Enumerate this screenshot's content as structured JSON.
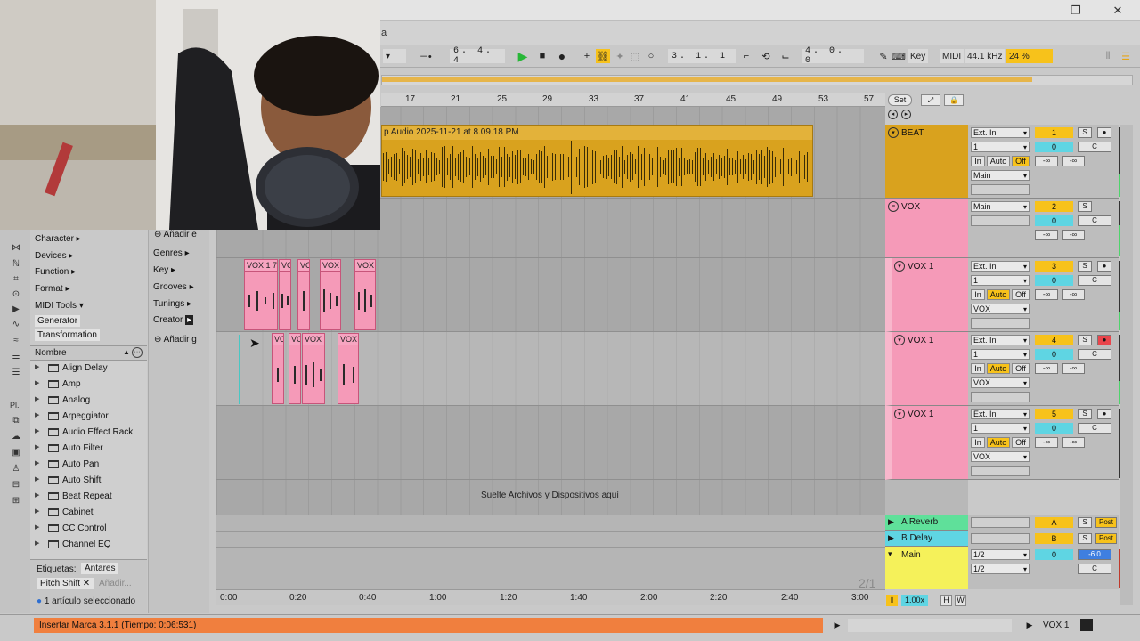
{
  "window": {
    "min": "—",
    "max": "❐",
    "close": "✕"
  },
  "menubar": {
    "title_fragment": "a"
  },
  "transport": {
    "quantize": "⊣•",
    "time_sig_pos": "6. 4. 4",
    "loop_start": "3. 1. 1",
    "loop_len": "4. 0. 0",
    "key_label": "Key",
    "midi_label": "MIDI",
    "sample_rate": "44.1 kHz",
    "cpu": "24 %"
  },
  "ruler": {
    "bars": [
      "17",
      "21",
      "25",
      "29",
      "33",
      "37",
      "41",
      "45",
      "49",
      "53",
      "57"
    ],
    "set_label": "Set"
  },
  "tracks": [
    {
      "name": "BEAT",
      "num": "1",
      "input": "Ext. In",
      "channel": "1",
      "out": "Main",
      "vol": "0",
      "pan": "C",
      "auto": "Auto",
      "off": "Off",
      "minf1": "-∞",
      "minf2": "-∞"
    },
    {
      "name": "VOX",
      "num": "2",
      "input": "Main",
      "vol": "0",
      "pan": "C",
      "minf1": "-∞",
      "minf2": "-∞"
    },
    {
      "name": "VOX 1",
      "num": "3",
      "input": "Ext. In",
      "channel": "1",
      "out": "VOX",
      "vol": "0",
      "pan": "C",
      "auto": "Auto",
      "off": "Off",
      "minf1": "-∞",
      "minf2": "-∞"
    },
    {
      "name": "VOX 1",
      "num": "4",
      "input": "Ext. In",
      "channel": "1",
      "out": "VOX",
      "vol": "0",
      "pan": "C",
      "auto": "Auto",
      "off": "Off",
      "minf1": "-∞",
      "minf2": "-∞"
    },
    {
      "name": "VOX 1",
      "num": "5",
      "input": "Ext. In",
      "channel": "1",
      "out": "VOX",
      "vol": "0",
      "pan": "C",
      "auto": "Auto",
      "off": "Off",
      "minf1": "-∞",
      "minf2": "-∞"
    }
  ],
  "returns": [
    {
      "name": "A Reverb",
      "letter": "A",
      "post": "Post",
      "color": "#5fe09a"
    },
    {
      "name": "B Delay",
      "letter": "B",
      "post": "Post",
      "color": "#5fd5e3"
    }
  ],
  "main": {
    "name": "Main",
    "io1": "1/2",
    "io2": "1/2",
    "vol": "0",
    "db": "-6.0",
    "pan": "C"
  },
  "clips": {
    "beat": "p Audio 2025-11-21 at 8.09.18 PM",
    "row3": [
      "VOX 1 7",
      "VC",
      "VO",
      "VOX",
      "VOX"
    ],
    "row4": [
      "VO",
      "VO",
      "VOX",
      "VOX"
    ]
  },
  "drop_text": "Suelte Archivos y Dispositivos aquí",
  "page_indicator": "2/1",
  "timeline": [
    "0:00",
    "0:20",
    "0:40",
    "1:00",
    "1:20",
    "1:40",
    "2:00",
    "2:20",
    "2:40",
    "3:00"
  ],
  "zoom": "1.00x",
  "hw": {
    "h": "H",
    "w": "W"
  },
  "browser": {
    "categories": [
      "Character",
      "Devices",
      "Function",
      "Format",
      "MIDI Tools"
    ],
    "subs": [
      "Generator",
      "Transformation"
    ],
    "filters": [
      "Añadir e",
      "Genres",
      "Key",
      "Grooves",
      "Tunings",
      "Creator",
      "Añadir g"
    ],
    "column_header": "Nombre",
    "items": [
      "Align Delay",
      "Amp",
      "Analog",
      "Arpeggiator",
      "Audio Effect Rack",
      "Auto Filter",
      "Auto Pan",
      "Auto Shift",
      "Beat Repeat",
      "Cabinet",
      "CC Control",
      "Channel EQ"
    ],
    "tags_label": "Etiquetas:",
    "tag_value": "Antares",
    "tag2": "Pitch Shift",
    "add_tag": "Añadir...",
    "selected": "1 artículo seleccionado",
    "places": "Pl."
  },
  "status": "Insertar Marca 3.1.1 (Tiempo: 0:06:531)",
  "bottom_right": {
    "track": "VOX 1"
  }
}
